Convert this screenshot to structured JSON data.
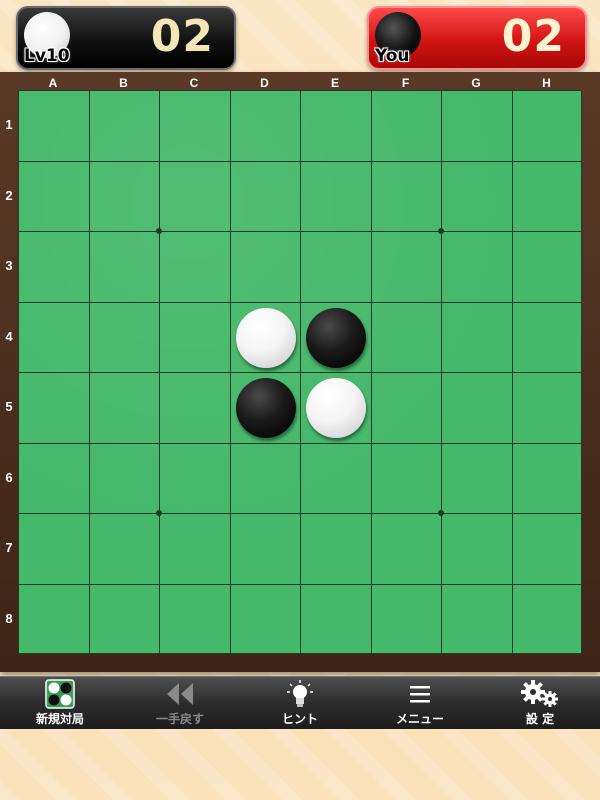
{
  "players": {
    "cpu": {
      "label": "Lv10",
      "score": "02",
      "disc": "white"
    },
    "you": {
      "label": "You",
      "score": "02",
      "disc": "black"
    }
  },
  "board": {
    "columns": [
      "A",
      "B",
      "C",
      "D",
      "E",
      "F",
      "G",
      "H"
    ],
    "rows": [
      "1",
      "2",
      "3",
      "4",
      "5",
      "6",
      "7",
      "8"
    ],
    "pieces": [
      {
        "cell": "D4",
        "color": "white"
      },
      {
        "cell": "E4",
        "color": "black"
      },
      {
        "cell": "D5",
        "color": "black"
      },
      {
        "cell": "E5",
        "color": "white"
      }
    ],
    "colors": {
      "felt": "#45b86a",
      "frame": "#4a2e1d",
      "grid": "#1f3a26"
    }
  },
  "toolbar": {
    "items": [
      {
        "label": "新規対局",
        "icon": "new-game-icon",
        "enabled": true
      },
      {
        "label": "一手戻す",
        "icon": "undo-icon",
        "enabled": false
      },
      {
        "label": "ヒント",
        "icon": "lightbulb-icon",
        "enabled": true
      },
      {
        "label": "メニュー",
        "icon": "menu-icon",
        "enabled": true
      },
      {
        "label": "設 定",
        "icon": "gear-icon",
        "enabled": true
      }
    ]
  },
  "theme": {
    "cpu_panel": "#111111",
    "you_panel": "#d11414",
    "background": "#f8dcb0"
  }
}
